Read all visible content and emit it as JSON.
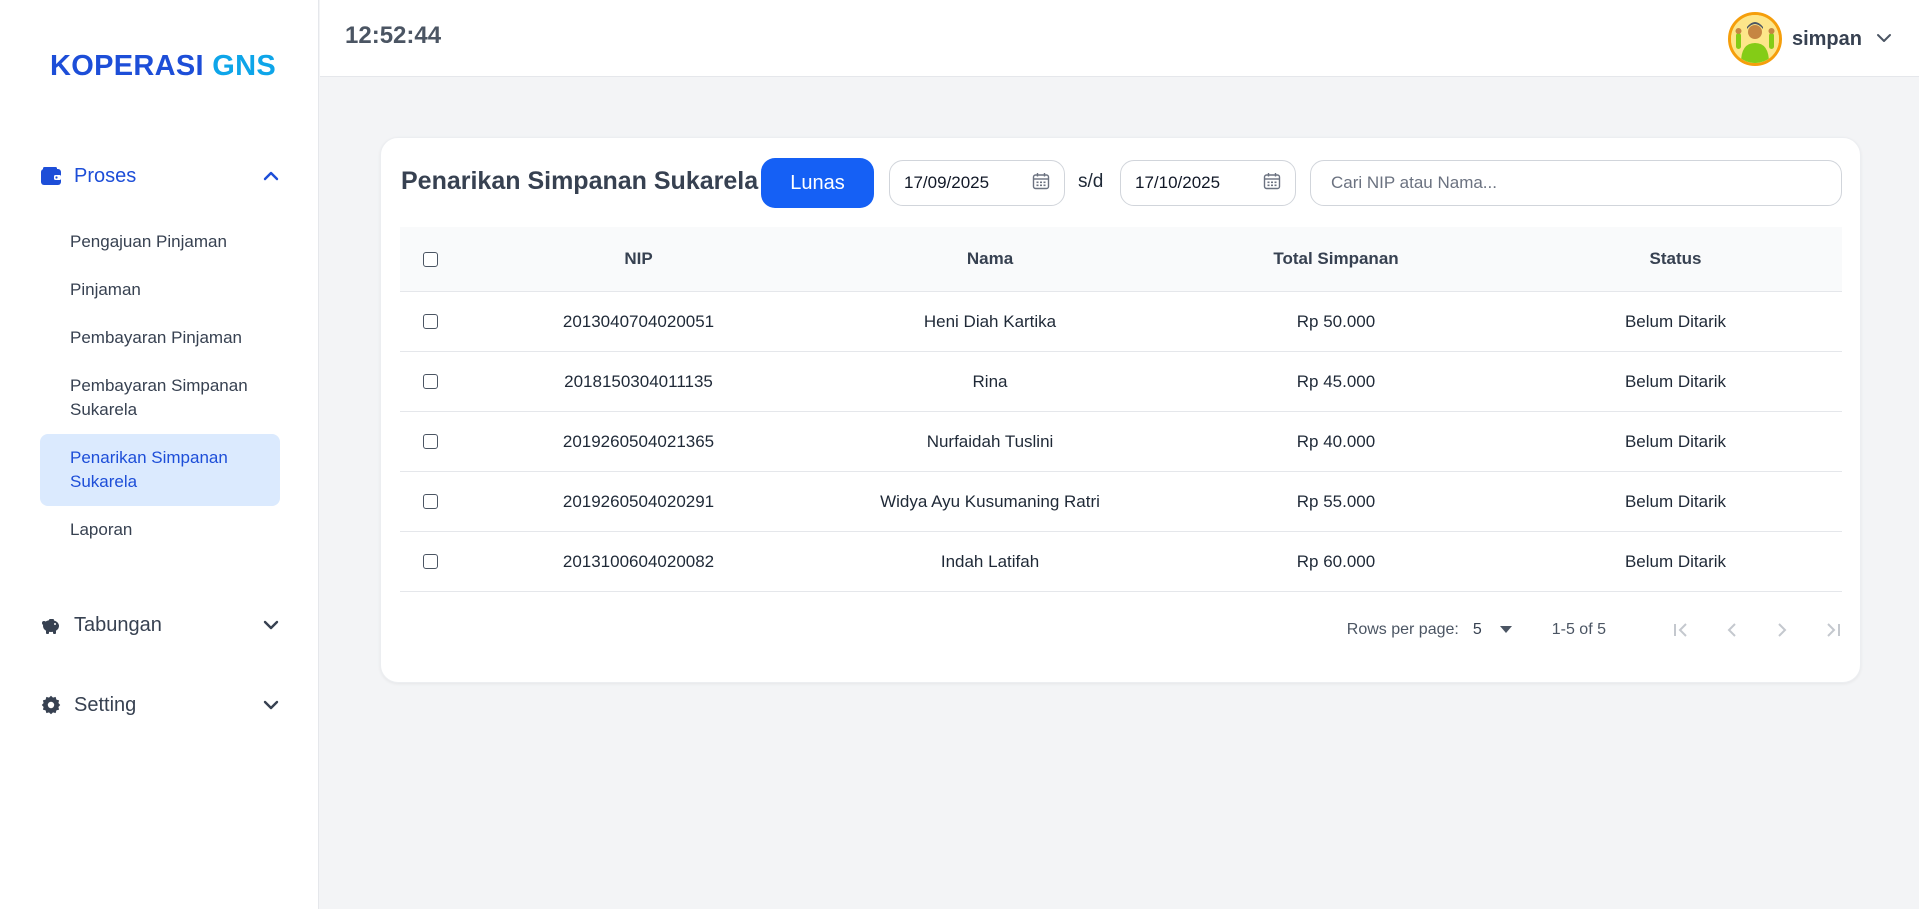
{
  "app": {
    "brand_primary": "KOPERASI",
    "brand_secondary": "GNS"
  },
  "colors": {
    "primary": "#1560f5",
    "brand": "#1d4ed8",
    "active_bg": "#dbeafe",
    "accent": "#0ea5e9"
  },
  "header": {
    "clock": "12:52:44",
    "username": "simpan"
  },
  "sidebar": {
    "groups": [
      {
        "label": "Proses",
        "icon": "wallet-icon",
        "expanded": true
      },
      {
        "label": "Tabungan",
        "icon": "piggy-bank-icon",
        "expanded": false
      },
      {
        "label": "Setting",
        "icon": "gear-icon",
        "expanded": false
      }
    ],
    "items": [
      {
        "label": "Pengajuan Pinjaman"
      },
      {
        "label": "Pinjaman"
      },
      {
        "label": "Pembayaran Pinjaman"
      },
      {
        "label": "Pembayaran Simpanan Sukarela"
      },
      {
        "label": "Penarikan Simpanan Sukarela",
        "active": true
      },
      {
        "label": "Laporan"
      }
    ]
  },
  "main": {
    "title": "Penarikan Simpanan Sukarela",
    "lunas_label": "Lunas",
    "date_from": "17/09/2025",
    "date_separator": "s/d",
    "date_to": "17/10/2025",
    "search_placeholder": "Cari NIP atau Nama...",
    "table": {
      "headers": {
        "nip": "NIP",
        "nama": "Nama",
        "total": "Total Simpanan",
        "status": "Status"
      },
      "rows": [
        {
          "nip": "2013040704020051",
          "nama": "Heni Diah Kartika",
          "total": "Rp 50.000",
          "status": "Belum Ditarik"
        },
        {
          "nip": "2018150304011135",
          "nama": "Rina",
          "total": "Rp 45.000",
          "status": "Belum Ditarik"
        },
        {
          "nip": "2019260504021365",
          "nama": "Nurfaidah Tuslini",
          "total": "Rp 40.000",
          "status": "Belum Ditarik"
        },
        {
          "nip": "2019260504020291",
          "nama": "Widya Ayu Kusumaning Ratri",
          "total": "Rp 55.000",
          "status": "Belum Ditarik"
        },
        {
          "nip": "2013100604020082",
          "nama": "Indah Latifah",
          "total": "Rp 60.000",
          "status": "Belum Ditarik"
        }
      ]
    },
    "pagination": {
      "rows_per_page_label": "Rows per page:",
      "rows_per_page": "5",
      "range": "1-5 of 5"
    }
  }
}
